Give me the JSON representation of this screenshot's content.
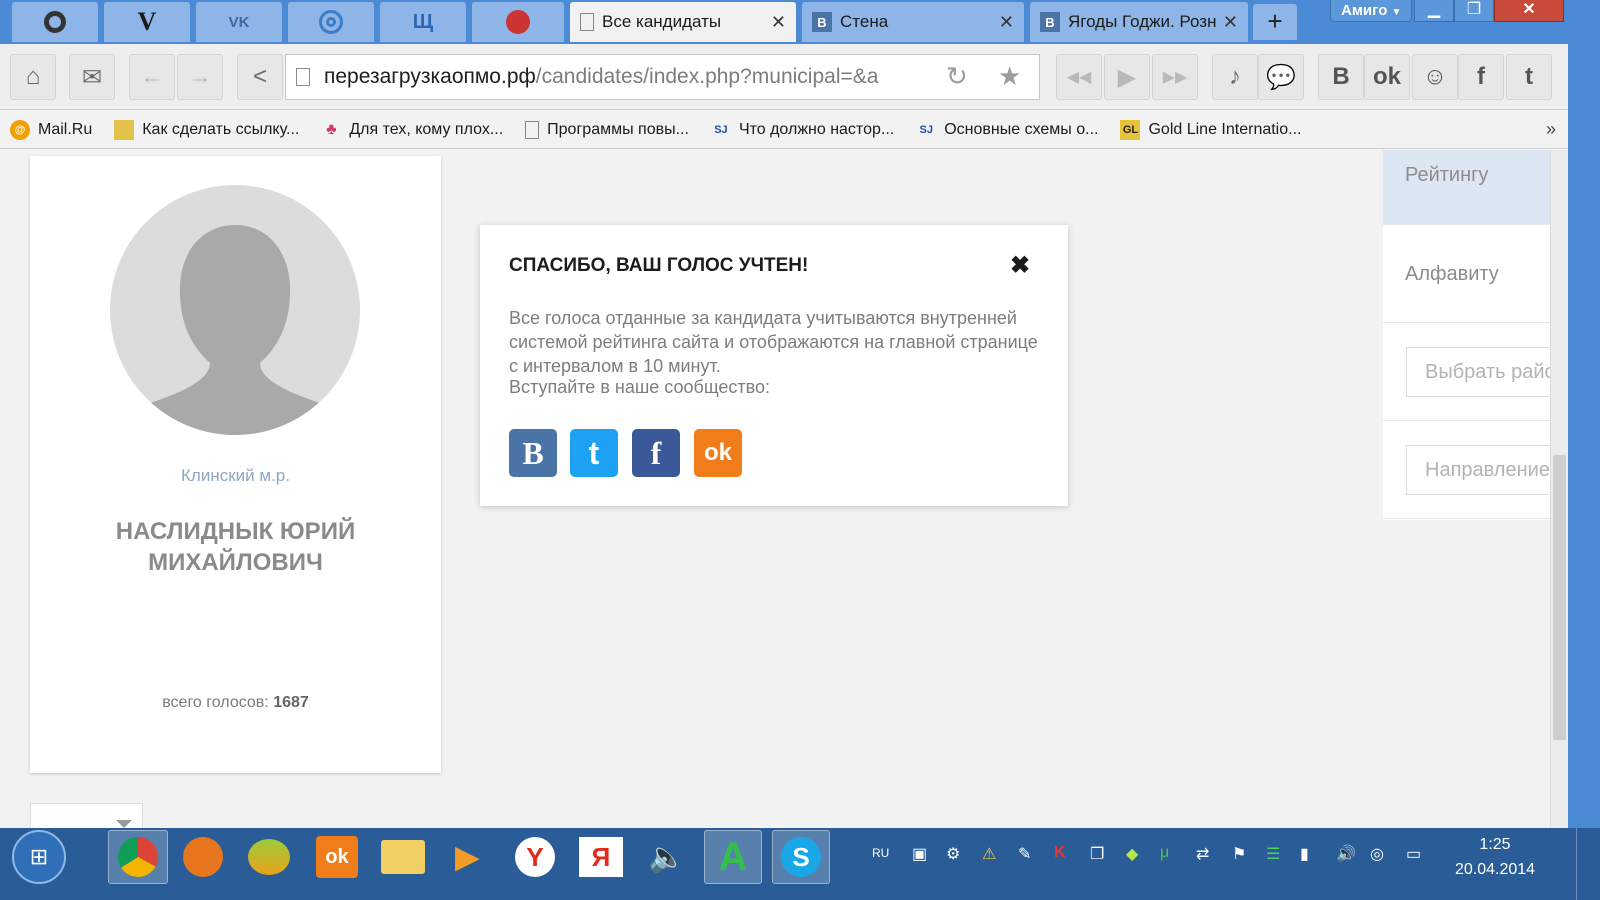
{
  "browser": {
    "window_label": "Амиго",
    "tabs": [
      {
        "label": "Все кандидаты",
        "icon": "page-icon"
      },
      {
        "label": "Стена",
        "icon": "vk-icon"
      },
      {
        "label": "Ягоды Годжи. Розн",
        "icon": "vk-icon"
      }
    ],
    "pinned_tabs": [
      "opera-icon",
      "v-icon",
      "vk-icon",
      "target-icon",
      "network-icon",
      "power-icon"
    ],
    "address": {
      "host": "перезагрузкаопмо.рф",
      "path": "/candidates/index.php?municipal=&a"
    },
    "bookmarks": [
      {
        "label": "Mail.Ru",
        "icon": "mailru-icon"
      },
      {
        "label": "Как сделать ссылку...",
        "icon": "folder-icon"
      },
      {
        "label": "Для тех, кому плох...",
        "icon": "people-icon"
      },
      {
        "label": "Программы повы...",
        "icon": "page-icon"
      },
      {
        "label": "Что должно настор...",
        "icon": "sj-icon"
      },
      {
        "label": "Основные схемы о...",
        "icon": "sj-icon"
      },
      {
        "label": "Gold Line Internatio...",
        "icon": "gl-icon"
      }
    ],
    "bookmarks_more": "»",
    "new_tab": "+"
  },
  "candidate": {
    "municipal": "Клинский м.р.",
    "name": "НАСЛИДНЫК ЮРИЙ МИХАЙЛОВИЧ",
    "votes_label": "всего голосов:",
    "votes_value": "1687"
  },
  "sidebar": {
    "sort_rating": "Рейтингу",
    "sort_alpha": "Алфавиту",
    "district_placeholder": "Выбрать район",
    "direction_placeholder": "Направление"
  },
  "modal": {
    "title": "СПАСИБО, ВАШ ГОЛОС УЧТЕН!",
    "close": "✖",
    "body": "Все голоса отданные за кандидата учитываются внутренней системой рейтинга сайта и отображаются на главной странице с интервалом в 10 минут.",
    "join": "Вступайте в наше сообщество:",
    "socials": [
      {
        "name": "vk",
        "glyph": "B",
        "color": "#4a74a5"
      },
      {
        "name": "twitter",
        "glyph": "t",
        "color": "#1da1f2"
      },
      {
        "name": "facebook",
        "glyph": "f",
        "color": "#3b5998"
      },
      {
        "name": "odnoklassniki",
        "glyph": "ok",
        "color": "#f07d1a"
      }
    ]
  },
  "taskbar": {
    "lang": "RU",
    "time": "1:25",
    "date": "20.04.2014",
    "apps": [
      "chrome-icon",
      "firefox-icon",
      "amigo-icon",
      "odnoklassniki-icon",
      "explorer-icon",
      "media-player-icon",
      "yandex-browser-icon",
      "yandex-icon",
      "sound-icon",
      "a-icon",
      "skype-icon"
    ]
  },
  "colors": {
    "chrome_blue": "#4b8bd6",
    "taskbar_blue": "#2a5d97",
    "accent_link": "#8ca7c3"
  }
}
